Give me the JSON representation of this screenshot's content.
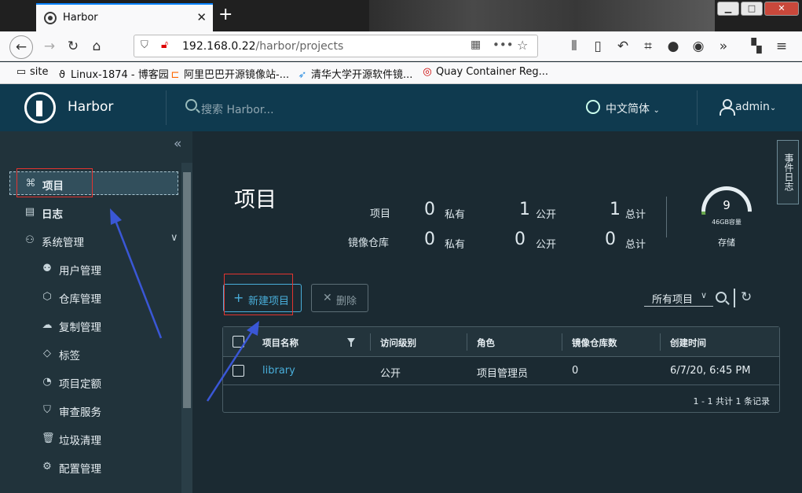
{
  "browser": {
    "tab_title": "Harbor",
    "url_host": "192.168.0.22",
    "url_path": "/harbor/projects",
    "bookmarks": [
      "site",
      "Linux-1874 - 博客园",
      "阿里巴巴开源镜像站-...",
      "清华大学开源软件镜...",
      "Quay Container Reg..."
    ]
  },
  "header": {
    "brand": "Harbor",
    "search_placeholder": "搜索 Harbor...",
    "language": "中文简体",
    "user": "admin"
  },
  "sidebar": {
    "items": [
      {
        "label": "项目",
        "icon": "project-icon"
      },
      {
        "label": "日志",
        "icon": "logs-icon"
      },
      {
        "label": "系统管理",
        "icon": "admin-icon"
      },
      {
        "label": "用户管理",
        "icon": "users-icon"
      },
      {
        "label": "仓库管理",
        "icon": "registry-icon"
      },
      {
        "label": "复制管理",
        "icon": "replication-icon"
      },
      {
        "label": "标签",
        "icon": "tag-icon"
      },
      {
        "label": "项目定额",
        "icon": "quota-icon"
      },
      {
        "label": "审查服务",
        "icon": "shield-icon"
      },
      {
        "label": "垃圾清理",
        "icon": "trash-icon"
      },
      {
        "label": "配置管理",
        "icon": "gear-icon"
      }
    ]
  },
  "event_log_tab": "事件日志",
  "page": {
    "title": "项目",
    "stats": {
      "projects_label": "项目",
      "repos_label": "镜像仓库",
      "private_label": "私有",
      "public_label": "公开",
      "total_label": "总计",
      "projects": {
        "private": "0",
        "public": "1",
        "total": "1"
      },
      "repos": {
        "private": "0",
        "public": "0",
        "total": "0"
      }
    },
    "storage": {
      "value": "9",
      "capacity": "46GB容量",
      "label": "存储"
    }
  },
  "toolbar": {
    "new_project": "新建项目",
    "delete": "删除",
    "filter": "所有项目"
  },
  "table": {
    "columns": [
      "项目名称",
      "访问级别",
      "角色",
      "镜像仓库数",
      "创建时间"
    ],
    "rows": [
      {
        "name": "library",
        "access": "公开",
        "role": "项目管理员",
        "repo_count": "0",
        "created": "6/7/20, 6:45 PM"
      }
    ],
    "footer": "1 - 1 共计 1 条记录"
  },
  "colors": {
    "header_bg": "#0f3a4f",
    "sidebar_bg": "#21333b",
    "main_bg": "#1b2a32",
    "accent": "#49aeda",
    "annotation_red": "#e3342f",
    "annotation_arrow": "#3a57d6"
  }
}
